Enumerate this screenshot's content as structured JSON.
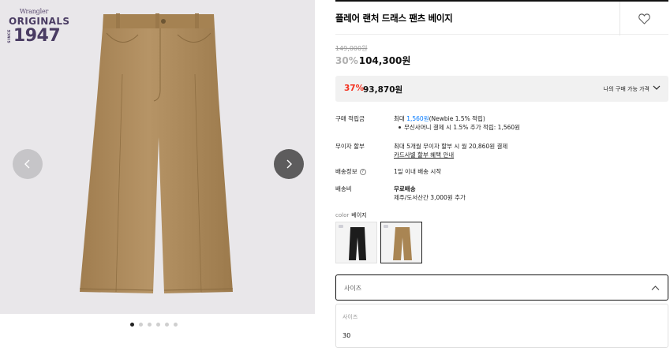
{
  "gallery": {
    "logo": {
      "brand": "Wrangler",
      "line": "ORIGINALS",
      "since": "SINCE",
      "year": "1947"
    },
    "prev_icon": "chevron-left-icon",
    "next_icon": "chevron-right-icon",
    "pager": {
      "count": 6,
      "active": 0
    },
    "product_color": "#b08d5c"
  },
  "product": {
    "title": "플레어 랜처 드래스 팬츠 베이지",
    "wish_icon": "heart-icon",
    "original_price": "149,000원",
    "discount_rate": "30%",
    "price": "104,300원"
  },
  "my_price": {
    "rate": "37%",
    "amount": "93,870원",
    "label": "나의 구매 가능 가격",
    "accent": "#f3311f"
  },
  "info": {
    "points": {
      "label": "구매 적립금",
      "prefix": "최대 ",
      "amount": "1,560원",
      "suffix": "(Newbie 1.5% 적립)",
      "sub": "무신사머니 결제 시 1.5% 추가 적립: 1,560원"
    },
    "installment": {
      "label": "무이자 할부",
      "text": "최대 5개월 무이자 할부 시 월 20,860원 결제",
      "link": "카드사별 할부 혜택 안내"
    },
    "shipping_info": {
      "label": "배송정보",
      "text": "1일 이내 배송 시작"
    },
    "shipping_fee": {
      "label": "배송비",
      "text": "무료배송",
      "sub": "제주/도서산간 3,000원 추가"
    }
  },
  "color": {
    "label": "color",
    "selected": "베이지",
    "options": [
      {
        "name": "black",
        "hex": "#1c1c1c"
      },
      {
        "name": "beige",
        "hex": "#a98553"
      }
    ]
  },
  "size": {
    "placeholder": "사이즈",
    "dropdown_header": "사이즈",
    "options": [
      "30"
    ]
  }
}
